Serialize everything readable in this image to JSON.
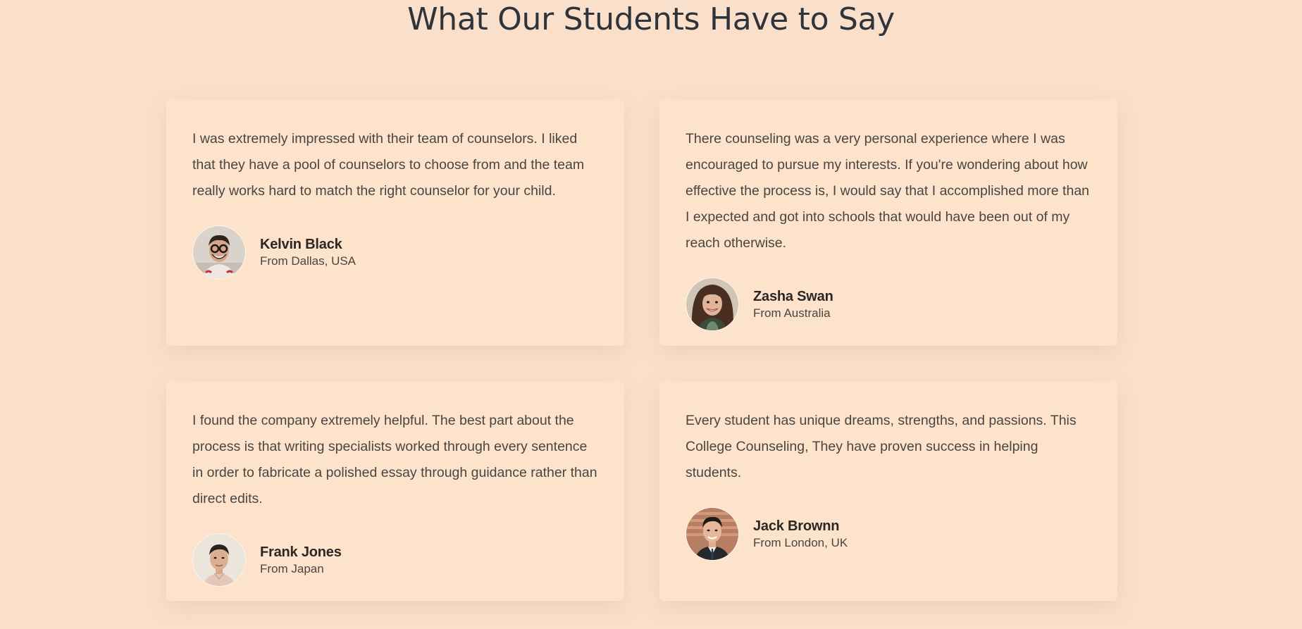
{
  "section": {
    "title": "What Our Students Have to Say"
  },
  "testimonials": [
    {
      "quote": "I was extremely impressed with their team of counselors. I liked that they have a pool of counselors to choose from and the team really works hard to match the right counselor for your child.",
      "name": "Kelvin Black",
      "origin": "From Dallas, USA"
    },
    {
      "quote": "There counseling was a very personal experience where I was encouraged to pursue my interests. If you're wondering about how effective the process is, I would say that I accomplished more than I expected and got into schools that would have been out of my reach otherwise.",
      "name": "Zasha Swan",
      "origin": "From Australia"
    },
    {
      "quote": "I found the company extremely helpful. The best part about the process is that writing specialists worked through every sentence in order to fabricate a polished essay through guidance rather than direct edits.",
      "name": "Frank Jones",
      "origin": "From Japan"
    },
    {
      "quote": "Every student has unique dreams, strengths, and passions. This College Counseling, They have proven success in helping students.",
      "name": "Jack Brownn",
      "origin": "From London, UK"
    }
  ],
  "colors": {
    "page_background": "#fae0cb",
    "card_background": "#fde3cc",
    "title_text": "#2f343b",
    "body_text": "#4a4541"
  }
}
